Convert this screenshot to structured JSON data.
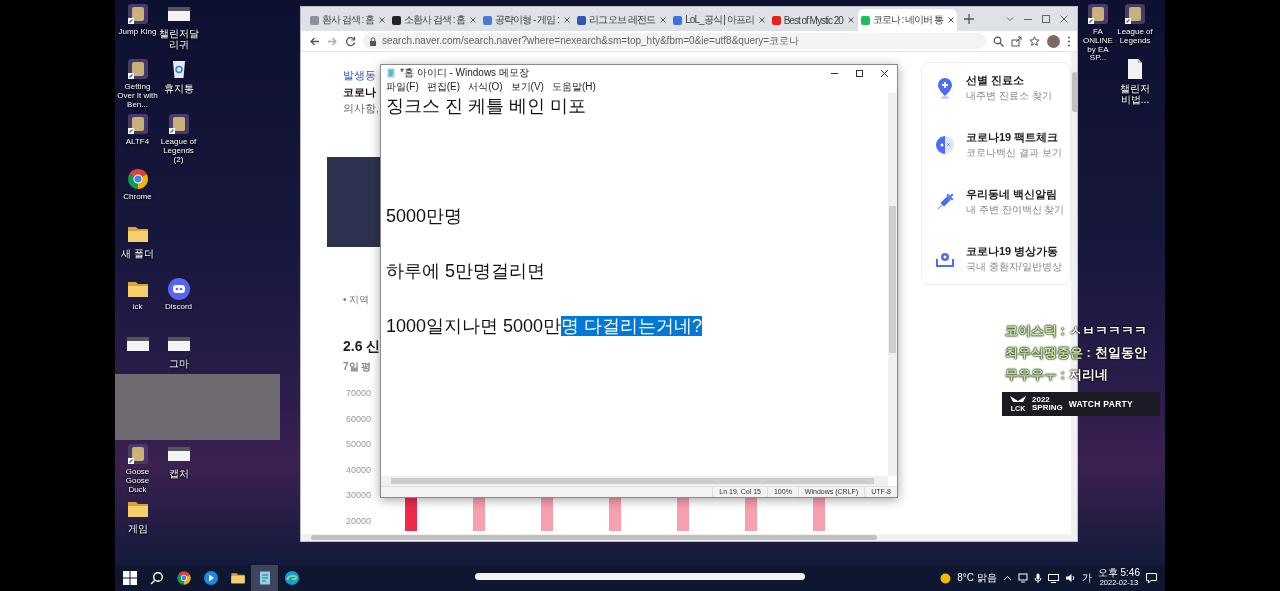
{
  "desktop_icons": [
    {
      "label": "Jump King",
      "kind": "game"
    },
    {
      "label": "Getting Over It with Ben...",
      "kind": "game"
    },
    {
      "label": "ALTF4",
      "kind": "game"
    },
    {
      "label": "Chrome",
      "kind": "browser"
    },
    {
      "label": "새 폴더",
      "kind": "folder"
    },
    {
      "label": "ick",
      "kind": "folder"
    },
    {
      "kind": "image"
    },
    {
      "kind": "empty"
    },
    {
      "label": "Goose Goose Duck",
      "kind": "game"
    },
    {
      "label": "게임",
      "kind": "folder"
    },
    {
      "label": "챌린저달리귀",
      "kind": "image"
    },
    {
      "label": "휴지통",
      "kind": "bin"
    },
    {
      "label": "League of Legends (2)",
      "kind": "game"
    },
    {
      "kind": "empty"
    },
    {
      "kind": "empty"
    },
    {
      "label": "Discord",
      "kind": "chat"
    },
    {
      "label": "그마",
      "kind": "image"
    },
    {
      "kind": "empty"
    },
    {
      "label": "캡처",
      "kind": "image"
    },
    {
      "kind": "empty"
    }
  ],
  "desktop_icons_right": [
    {
      "label": "FA ONLINE by EA SP...",
      "kind": "game"
    },
    {
      "label": "League of Legends",
      "kind": "game"
    },
    {
      "kind": "empty"
    },
    {
      "label": "챌린저비법...",
      "kind": "document"
    }
  ],
  "browser": {
    "tabs": [
      {
        "title": "환사 검색 : 홈",
        "color": "#8a8f99",
        "selected": false
      },
      {
        "title": "소환사 검색 : 홈",
        "color": "#222222",
        "selected": false
      },
      {
        "title": "공략이형 - 게임 :",
        "color": "#4a7bd0",
        "selected": false
      },
      {
        "title": "리그 오브 레전드",
        "color": "#2f55b5",
        "selected": false
      },
      {
        "title": "LoL_공식 | 아프리",
        "color": "#3d6fe0",
        "selected": false
      },
      {
        "title": "Best of Mystic 20",
        "color": "#e62117",
        "selected": false
      },
      {
        "title": "코로나 : 네이버 통",
        "color": "#19c15a",
        "selected": true
      }
    ],
    "url": "search.naver.com/search.naver?where=nexearch&sm=top_hty&fbm=0&ie=utf8&query=코로나",
    "left_texts": [
      {
        "text": "발생동",
        "kind": "link"
      },
      {
        "text": "코로나",
        "kind": "bold"
      },
      {
        "text": "의사항,",
        "kind": "muted"
      }
    ],
    "bullet_text": "• 지역",
    "section_title": "2.6 신",
    "section_subtitle": "7일 평",
    "chart": {
      "y_tick_labels": [
        "70000",
        "60000",
        "50000",
        "40000",
        "30000",
        "20000"
      ],
      "bars": [
        {
          "highlighted": true
        },
        {
          "highlighted": false
        },
        {
          "highlighted": false
        },
        {
          "highlighted": false
        },
        {
          "highlighted": false
        },
        {
          "highlighted": false
        },
        {
          "highlighted": false
        }
      ]
    },
    "services": [
      {
        "title": "선별 진료소",
        "subtitle": "내주변 진료소 찾기",
        "kind": "pin"
      },
      {
        "title": "코로나19 팩트체크",
        "subtitle": "코로나백신 결과 보기",
        "kind": "half_circle"
      },
      {
        "title": "우리동네 백신알림",
        "subtitle": "내 주변 잔여백신 찾기",
        "kind": "syringe"
      },
      {
        "title": "코로나19 병상가동",
        "subtitle": "국내 중환자/일반병상",
        "kind": "bed"
      }
    ]
  },
  "notepad": {
    "title": "*홈 아이디 - Windows 메모장",
    "menu": [
      "파일(F)",
      "편집(E)",
      "서식(O)",
      "보기(V)",
      "도움말(H)"
    ],
    "lines": [
      {
        "kind": "text",
        "segments": [
          {
            "text": "징크스 진 케틀 베인 미포",
            "selected": false
          }
        ]
      },
      {
        "kind": "blank"
      },
      {
        "kind": "blank"
      },
      {
        "kind": "blank"
      },
      {
        "kind": "text",
        "segments": [
          {
            "text": "5000만명",
            "selected": false
          }
        ]
      },
      {
        "kind": "blank"
      },
      {
        "kind": "text",
        "segments": [
          {
            "text": "하루에 5만명걸리면",
            "selected": false
          }
        ]
      },
      {
        "kind": "blank"
      },
      {
        "kind": "text",
        "segments": [
          {
            "text": "1000일지나면 5000만",
            "selected": false
          },
          {
            "text": "명 다걸리는거네?",
            "selected": true
          }
        ]
      }
    ],
    "status": [
      "Ln 19, Col 15",
      "100%",
      "Windows (CRLF)",
      "UTF-8"
    ]
  },
  "webcam": {
    "kind": "video"
  },
  "chat": [
    {
      "user": "코이스틱 :",
      "text": "ㅅㅂㅋㅋㅋㅋ"
    },
    {
      "user": "최우식팽중은 :",
      "text": "천일동안"
    },
    {
      "user": "무우우ㅜ :",
      "text": "저리네"
    }
  ],
  "banner": {
    "league": "LCK",
    "year": "2022",
    "season": "SPRING",
    "event": "WATCH PARTY"
  },
  "taskbar": {
    "apps": [
      {
        "kind": "start",
        "selected": false
      },
      {
        "kind": "search",
        "selected": false
      },
      {
        "kind": "browser",
        "selected": false
      },
      {
        "kind": "media",
        "selected": false
      },
      {
        "kind": "explorer",
        "selected": false
      },
      {
        "kind": "notepad",
        "selected": true
      },
      {
        "kind": "edge",
        "selected": false
      }
    ],
    "weather": "8°C 맑음",
    "ime": "가",
    "time": "오후 5:46",
    "date": "2022-02-13"
  }
}
